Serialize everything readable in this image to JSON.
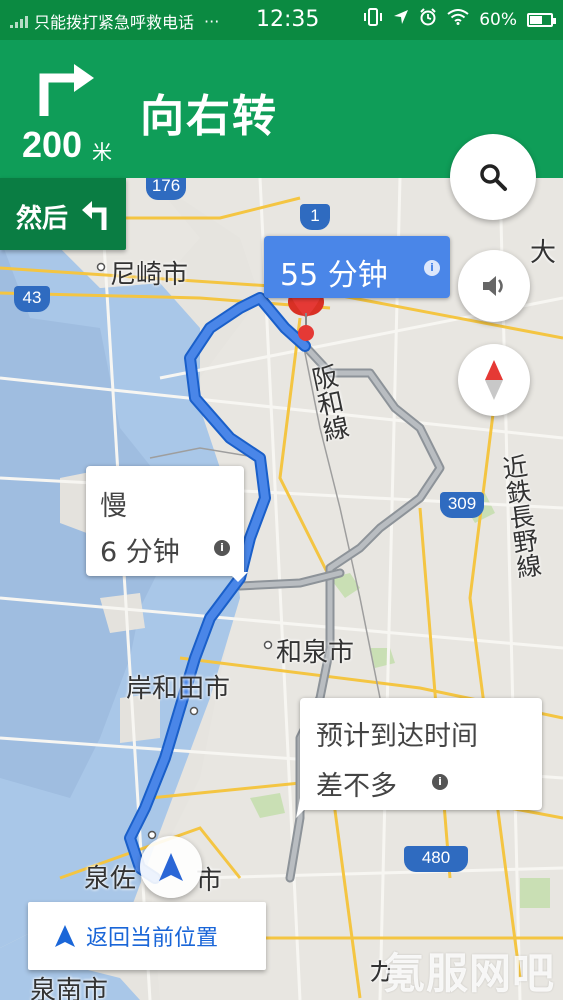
{
  "status_bar": {
    "carrier": "只能拨打紧急呼救电话",
    "more": "···",
    "time": "12:35",
    "battery": "60%",
    "battery_level": 0.6,
    "icons": [
      "vibrate-icon",
      "location-arrow-icon",
      "alarm-icon",
      "wifi-icon",
      "battery-icon"
    ]
  },
  "navigation": {
    "distance": "200",
    "distance_unit": "米",
    "instruction": "向右转",
    "turn_icon": "turn-right-icon",
    "then_label": "然后",
    "then_icon": "turn-left-icon"
  },
  "map": {
    "route_time": "55 分钟",
    "alt_route_label": "慢",
    "alt_route_time": "6 分钟",
    "eta_note_line1": "预计到达时间",
    "eta_note_line2": "差不多",
    "labels": {
      "amagasaki": "尼崎市",
      "hanwa_line": "阪和線",
      "kintetsu_line": "近鉄長野線",
      "izumi": "和泉市",
      "kishiwada": "岸和田市",
      "izumisano": "泉佐",
      "izumisano_tail": "市",
      "sennan": "泉南市",
      "ka": "カ",
      "osaka_fragment": "大"
    },
    "shields": {
      "r176": "176",
      "r1": "1",
      "r43": "43",
      "r309": "309",
      "r480": "480"
    },
    "colors": {
      "route": "#4a86e8",
      "alt_route": "#9aa0a6",
      "destination": "#e53935",
      "water": "#a9c7e8",
      "land": "#e8e6e1"
    }
  },
  "controls": {
    "search_icon": "search-icon",
    "sound_icon": "volume-icon",
    "compass_icon": "compass-icon",
    "recenter_label": "返回当前位置"
  },
  "watermark": "氪服网吧"
}
